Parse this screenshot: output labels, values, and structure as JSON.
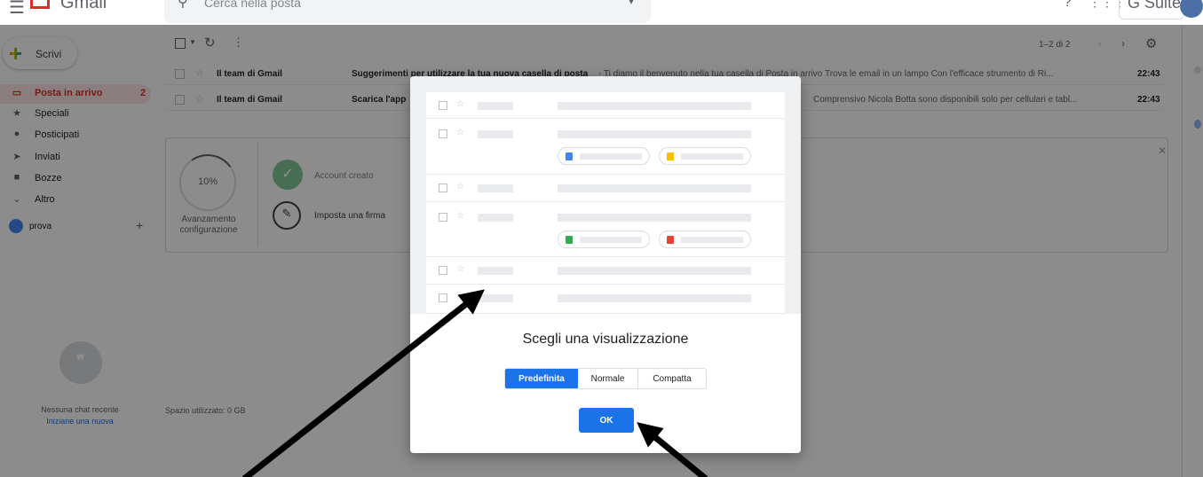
{
  "header": {
    "app_name": "Gmail",
    "search_placeholder": "Cerca nella posta",
    "brand": "G Suite"
  },
  "sidebar": {
    "compose_label": "Scrivi",
    "items": [
      {
        "label": "Posta in arrivo",
        "count": "2",
        "icon": "inbox-icon"
      },
      {
        "label": "Speciali",
        "icon": "star-icon"
      },
      {
        "label": "Posticipati",
        "icon": "clock-icon"
      },
      {
        "label": "Inviati",
        "icon": "send-icon"
      },
      {
        "label": "Bozze",
        "icon": "draft-icon"
      },
      {
        "label": "Altro",
        "icon": "chevron-down-icon"
      }
    ],
    "account_label": "prova",
    "no_recent_chat": "Nessuna chat recente",
    "start_new_chat": "Iniziane una nuova"
  },
  "toolbar": {
    "pagination": "1–2 di 2"
  },
  "emails": [
    {
      "sender": "Il team di Gmail",
      "subject": "Suggerimenti per utilizzare la tua nuova casella di posta",
      "preview": " - Ti diamo il benvenuto nella tua casella di Posta in arrivo Trova le email in un lampo Con l'efficace strumento di Ri...",
      "time": "22:43"
    },
    {
      "sender": "Il team di Gmail",
      "subject": "Scarica l'app",
      "preview": "Comprensivo Nicola Botta sono disponibili solo per cellulari e tabl...",
      "time": "22:43"
    }
  ],
  "setup": {
    "progress_percent": "10%",
    "progress_label_1": "Avanzamento",
    "progress_label_2": "configurazione",
    "step_done": "Account creato",
    "step_signature": "Imposta una firma"
  },
  "storage": "Spazio utilizzato: 0 GB",
  "dialog": {
    "title": "Scegli una visualizzazione",
    "options": [
      "Predefinita",
      "Normale",
      "Compatta"
    ],
    "selected": "Predefinita",
    "ok_label": "OK"
  },
  "colors": {
    "accent": "#1a73e8",
    "inbox_red": "#d93025"
  }
}
